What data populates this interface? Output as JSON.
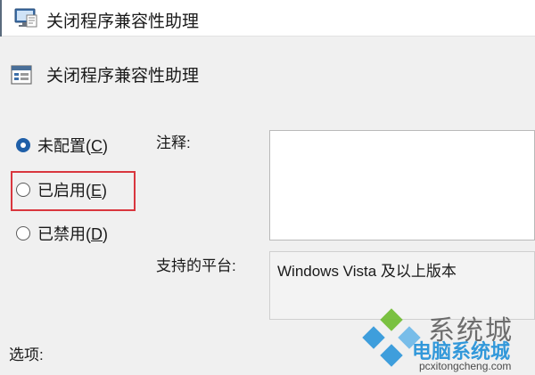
{
  "window": {
    "title": "关闭程序兼容性助理",
    "icon": "policy-setting-icon"
  },
  "header": {
    "title": "关闭程序兼容性助理",
    "icon": "policy-icon"
  },
  "options": [
    {
      "before": "未配置(",
      "key": "C",
      "after": ")",
      "selected": true
    },
    {
      "before": "已启用(",
      "key": "E",
      "after": ")",
      "selected": false,
      "highlighted": true
    },
    {
      "before": "已禁用(",
      "key": "D",
      "after": ")",
      "selected": false
    }
  ],
  "comment": {
    "label": "注释:",
    "value": ""
  },
  "platform": {
    "label": "支持的平台:",
    "value": "Windows Vista 及以上版本"
  },
  "options_section": {
    "label": "选项:"
  },
  "watermark": {
    "brand": "系统城",
    "sub": "电脑系统城",
    "url": "pcxitongcheng.com"
  },
  "colors": {
    "highlight_box": "#d9363e",
    "radio_selected": "#1f5fa8",
    "watermark_blue": "#1e8fd8",
    "watermark_green": "#6dbb2e"
  }
}
